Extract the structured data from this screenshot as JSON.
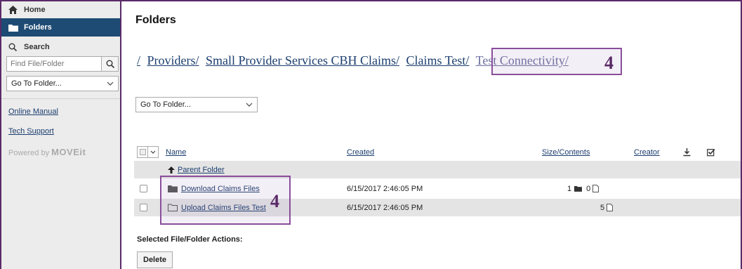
{
  "sidebar": {
    "home": "Home",
    "folders": "Folders",
    "search": "Search",
    "find_placeholder": "Find File/Folder",
    "goto": "Go To Folder...",
    "online_manual": "Online Manual",
    "tech_support": "Tech Support",
    "powered_by": "Powered by",
    "logo": "MOVEit"
  },
  "main": {
    "title": "Folders",
    "breadcrumb": [
      "/",
      "Providers/",
      "Small Provider Services CBH Claims/",
      "Claims Test/",
      "Test Connectivity/"
    ],
    "callout_number": "4",
    "goto": "Go To Folder...",
    "columns": {
      "name": "Name",
      "created": "Created",
      "size": "Size/Contents",
      "creator": "Creator"
    },
    "parent_folder": "Parent Folder",
    "rows": [
      {
        "name": "Download Claims Files",
        "created": "6/15/2017 2:46:05 PM",
        "folders": "1",
        "files": "0"
      },
      {
        "name": "Upload Claims Files Test",
        "created": "6/15/2017 2:46:05 PM",
        "folders": "",
        "files": "5"
      }
    ],
    "actions_label": "Selected File/Folder Actions:",
    "delete_label": "Delete"
  },
  "colors": {
    "nav_active": "#1e4b73",
    "link": "#1b3d6e",
    "highlight": "#8a4e9b"
  }
}
